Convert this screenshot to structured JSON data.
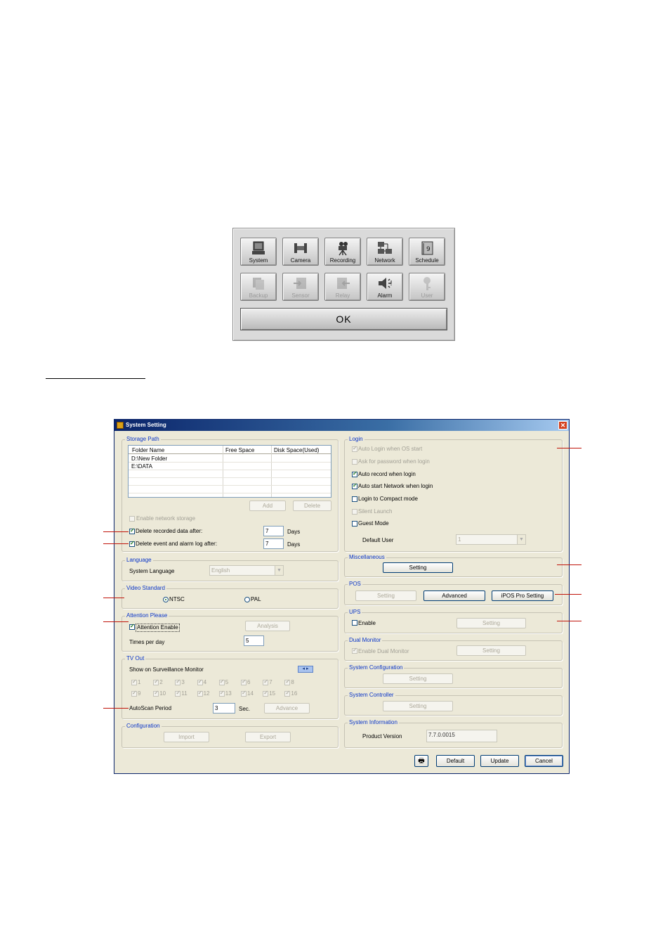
{
  "toolbar": {
    "row1": [
      {
        "label": "System",
        "icon": "system-icon",
        "enabled": true
      },
      {
        "label": "Camera",
        "icon": "camera-icon",
        "enabled": true
      },
      {
        "label": "Recording",
        "icon": "recording-icon",
        "enabled": true
      },
      {
        "label": "Network",
        "icon": "network-icon",
        "enabled": true
      },
      {
        "label": "Schedule",
        "icon": "schedule-icon",
        "enabled": true
      }
    ],
    "row2": [
      {
        "label": "Backup",
        "icon": "backup-icon",
        "enabled": false
      },
      {
        "label": "Sensor",
        "icon": "sensor-icon",
        "enabled": false
      },
      {
        "label": "Relay",
        "icon": "relay-icon",
        "enabled": false
      },
      {
        "label": "Alarm",
        "icon": "alarm-icon",
        "enabled": true
      },
      {
        "label": "User",
        "icon": "user-icon",
        "enabled": false
      }
    ],
    "ok_label": "OK"
  },
  "dialog": {
    "title": "System Setting",
    "close_glyph": "✕",
    "storage": {
      "title": "Storage Path",
      "columns": [
        "Folder Name",
        "Free Space",
        "Disk Space(Used)"
      ],
      "rows": [
        [
          "D:\\New Folder",
          "",
          ""
        ],
        [
          "E:\\DATA",
          "",
          ""
        ]
      ],
      "add_label": "Add",
      "delete_label": "Delete",
      "enable_network_storage": "Enable network storage",
      "delete_recorded_label": "Delete recorded data after:",
      "delete_recorded_value": "7",
      "delete_event_label": "Delete event and alarm log after:",
      "delete_event_value": "7",
      "days_label": "Days"
    },
    "language": {
      "title": "Language",
      "label": "System Language",
      "value": "English"
    },
    "video_standard": {
      "title": "Video Standard",
      "ntsc": "NTSC",
      "pal": "PAL",
      "selected": "NTSC"
    },
    "attention": {
      "title": "Attention Please",
      "enable_label": "Attention Enable",
      "analysis_label": "Analysis",
      "times_label": "Times per day",
      "times_value": "5"
    },
    "tvout": {
      "title": "TV Out",
      "show_label": "Show on Surveillance Monitor",
      "nav_glyphs": "◂ ▸",
      "channels": [
        "1",
        "2",
        "3",
        "4",
        "5",
        "6",
        "7",
        "8",
        "9",
        "10",
        "11",
        "12",
        "13",
        "14",
        "15",
        "16"
      ],
      "autoscan_label": "AutoScan Period",
      "autoscan_value": "3",
      "sec_label": "Sec.",
      "advance_label": "Advance"
    },
    "configuration": {
      "title": "Configuration",
      "import_label": "Import",
      "export_label": "Export"
    },
    "login": {
      "title": "Login",
      "auto_login": "Auto Login when OS start",
      "ask_password": "Ask for password when login",
      "auto_record": "Auto record when login",
      "auto_network": "Auto start Network when login",
      "compact_mode": "Login to Compact mode",
      "silent_launch": "Silent Launch",
      "guest_mode": "Guest Mode",
      "default_user_label": "Default User",
      "default_user_value": "1"
    },
    "misc": {
      "title": "Miscellaneous",
      "setting_label": "Setting"
    },
    "pos": {
      "title": "POS",
      "setting_label": "Setting",
      "advanced_label": "Advanced",
      "ipos_label": "iPOS Pro Setting"
    },
    "ups": {
      "title": "UPS",
      "enable_label": "Enable",
      "setting_label": "Setting"
    },
    "dual_monitor": {
      "title": "Dual Monitor",
      "enable_label": "Enable Dual Monitor",
      "setting_label": "Setting"
    },
    "sys_config": {
      "title": "System Configuration",
      "setting_label": "Setting"
    },
    "sys_controller": {
      "title": "System Controller",
      "setting_label": "Setting"
    },
    "sys_info": {
      "title": "System Information",
      "product_version_label": "Product Version",
      "product_version_value": "7.7.0.0015"
    },
    "footer": {
      "printer_glyph": "🖶",
      "default_label": "Default",
      "update_label": "Update",
      "cancel_label": "Cancel"
    }
  },
  "colors": {
    "dialog_bg": "#ece9d8",
    "group_title": "#0a35c8",
    "titlebar": "#0a246a",
    "callout_line": "#c0140a"
  }
}
